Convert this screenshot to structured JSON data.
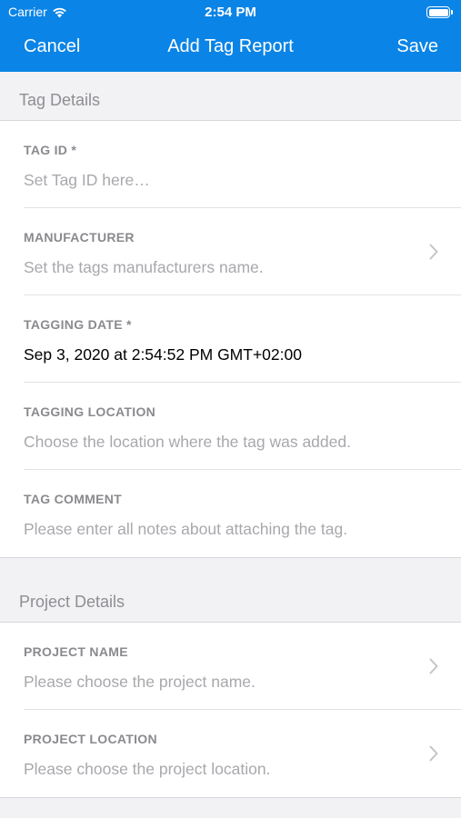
{
  "status_bar": {
    "carrier": "Carrier",
    "time": "2:54 PM"
  },
  "nav": {
    "cancel_label": "Cancel",
    "title": "Add Tag Report",
    "save_label": "Save"
  },
  "sections": [
    {
      "header": "Tag Details",
      "rows": [
        {
          "label": "TAG ID *",
          "value": "Set Tag ID here…",
          "placeholder": true,
          "chevron": false
        },
        {
          "label": "MANUFACTURER",
          "value": "Set the tags manufacturers name.",
          "placeholder": true,
          "chevron": true
        },
        {
          "label": "TAGGING DATE *",
          "value": "Sep 3, 2020 at 2:54:52 PM GMT+02:00",
          "placeholder": false,
          "chevron": false
        },
        {
          "label": "TAGGING LOCATION",
          "value": "Choose the location where the tag was added.",
          "placeholder": true,
          "chevron": false
        },
        {
          "label": "TAG COMMENT",
          "value": "Please enter all notes about attaching the tag.",
          "placeholder": true,
          "chevron": false
        }
      ]
    },
    {
      "header": "Project Details",
      "rows": [
        {
          "label": "PROJECT NAME",
          "value": "Please choose the project name.",
          "placeholder": true,
          "chevron": true
        },
        {
          "label": "PROJECT LOCATION",
          "value": "Please choose the project location.",
          "placeholder": true,
          "chevron": true
        }
      ]
    }
  ],
  "colors": {
    "nav_background": "#0a84e6",
    "placeholder_text": "#a8a8ad",
    "label_text": "#8a8a8f",
    "grouped_background": "#f2f2f4"
  },
  "icons": {
    "wifi": "wifi-icon",
    "battery": "battery-icon",
    "chevron": "chevron-right-icon"
  }
}
